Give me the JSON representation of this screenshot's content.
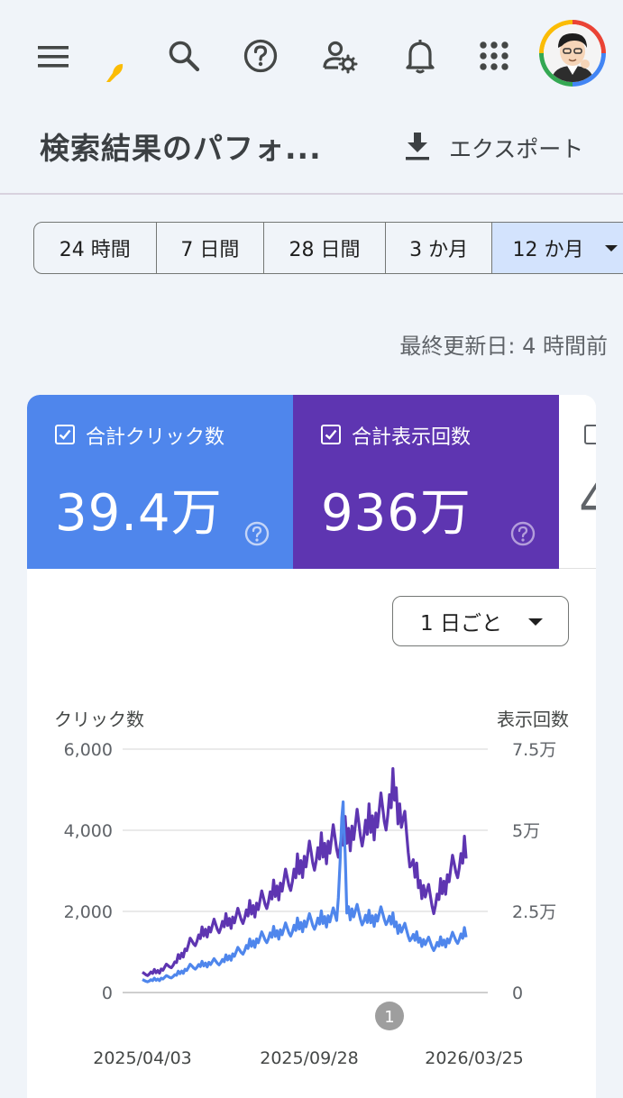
{
  "appbar": {
    "icons": [
      "menu-icon",
      "search-icon",
      "help-icon",
      "manage-users-icon",
      "notifications-icon",
      "apps-grid-icon"
    ]
  },
  "header": {
    "title": "検索結果のパフォ...",
    "export_label": "エクスポート"
  },
  "range": {
    "options": [
      "24 時間",
      "7 日間",
      "28 日間",
      "3 か月",
      "12 か月"
    ],
    "selected": "12 か月"
  },
  "last_updated": "最終更新日: 4 時間前",
  "metrics": [
    {
      "label": "合計クリック数",
      "value": "39.4万",
      "color": "#4f86ec",
      "checked": true
    },
    {
      "label": "合計表示回数",
      "value": "936万",
      "color": "#5e35b1",
      "checked": true
    },
    {
      "label": "",
      "value": "4",
      "checked": false
    }
  ],
  "aggregation": "1 日ごと",
  "chart_data": {
    "type": "line",
    "left_axis": {
      "label": "クリック数",
      "ticks": [
        "0",
        "2,000",
        "4,000",
        "6,000"
      ],
      "range": [
        0,
        6000
      ]
    },
    "right_axis": {
      "label": "表示回数",
      "ticks": [
        "0",
        "2.5万",
        "5万",
        "7.5万"
      ],
      "range": [
        0,
        75000
      ]
    },
    "x_ticks": [
      "2025/04/03",
      "2025/09/28",
      "2026/03/25"
    ],
    "annotation": "1",
    "series": [
      {
        "name": "合計クリック数",
        "axis": "left",
        "color": "#4f86ec",
        "x": [
          0,
          0.05,
          0.1,
          0.15,
          0.2,
          0.25,
          0.3,
          0.35,
          0.4,
          0.45,
          0.5,
          0.55,
          0.6,
          0.62,
          0.63,
          0.65,
          0.7,
          0.75,
          0.8,
          0.85,
          0.9,
          0.95,
          1
        ],
        "y": [
          280,
          320,
          420,
          620,
          700,
          780,
          1000,
          1250,
          1420,
          1520,
          1680,
          1760,
          1850,
          4700,
          2050,
          1950,
          1780,
          1880,
          1550,
          1300,
          1150,
          1280,
          1420
        ]
      },
      {
        "name": "合計表示回数",
        "axis": "right",
        "color": "#5e35b1",
        "x": [
          0,
          0.05,
          0.1,
          0.15,
          0.2,
          0.25,
          0.3,
          0.35,
          0.4,
          0.45,
          0.5,
          0.55,
          0.6,
          0.65,
          0.7,
          0.75,
          0.78,
          0.8,
          0.85,
          0.9,
          0.95,
          1
        ],
        "y": [
          5500,
          6500,
          9000,
          15000,
          19000,
          21000,
          23000,
          26000,
          30000,
          34000,
          40000,
          43000,
          46000,
          49000,
          51000,
          55000,
          62000,
          53000,
          34000,
          27000,
          36000,
          43000
        ]
      }
    ]
  }
}
